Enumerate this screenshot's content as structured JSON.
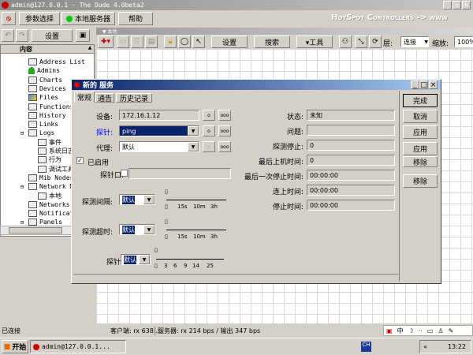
{
  "window": {
    "title": "admin@127.0.0.1 - The Dude 4.0beta2",
    "brand": "HotSpot Controllers -> www"
  },
  "menubar": {
    "prefs": "参数选择",
    "local_server": "本地服务器",
    "help": "帮助"
  },
  "left_toolbar": {
    "settings": "设置"
  },
  "map": {
    "title": "本地",
    "settings": "设置",
    "search": "搜索",
    "tools": "▾工具",
    "layer_label": "层:",
    "layer_value": "连接",
    "zoom_label": "缩放:",
    "zoom_value": "100%"
  },
  "tree": {
    "header": "内容",
    "items": [
      "Address List",
      "Admins",
      "Charts",
      "Devices",
      "Files",
      "Functions",
      "History ...",
      "Links",
      "Logs",
      "事件",
      "系统日志",
      "行为",
      "调试工具",
      "Mib Nodes",
      "Network Maps",
      "本地",
      "Networks",
      "Notifications",
      "Panels"
    ]
  },
  "dialog": {
    "title": "新的 服务",
    "tabs": [
      "常规",
      "通告",
      "历史记录"
    ],
    "device_label": "设备:",
    "device_value": "172.16.1.12",
    "probe_label": "探针:",
    "probe_value": "ping",
    "agent_label": "代理:",
    "agent_value": "默认",
    "enabled_label": "已启用",
    "port_label": "探针口:",
    "interval_label": "探测间隔:",
    "interval_value": "默认",
    "timeout_label": "探测超时:",
    "timeout_value": "默认",
    "down_count_label": "探针停止数:",
    "down_count_value": "默认",
    "time_ticks": [
      "15s",
      "10m",
      "3h"
    ],
    "count_ticks": [
      "3",
      "6",
      "9",
      "14",
      "25"
    ],
    "status_label": "状态:",
    "status_value": "未知",
    "problem_label": "问题:",
    "problem_value": "",
    "probe_down_label": "探测停止:",
    "probe_down_value": "0",
    "last_up_label": "最后上机时间:",
    "last_up_value": "0",
    "last_down_label": "最后一次停止时间:",
    "last_down_value": "00:00:00",
    "uptime_label": "连上时间:",
    "uptime_value": "00:00:00",
    "downtime_label": "停止时间:",
    "downtime_value": "00:00:00",
    "buttons": [
      "完成",
      "取消",
      "应用",
      "应用",
      "移除",
      "移除"
    ],
    "small_btn": "o",
    "dots_btn": "ooo"
  },
  "statusbar": {
    "connection": "已连接",
    "client": "客户端: rx 638 ...",
    "server": "服务器: rx 214 bps / 输出 347 bps"
  },
  "taskbar": {
    "start": "开始",
    "task": "admin@127.0.0.1...",
    "ime": "中",
    "time": "13:22"
  },
  "colors": {
    "title_active": "#0a246a",
    "probe_label": "#0000ff"
  }
}
